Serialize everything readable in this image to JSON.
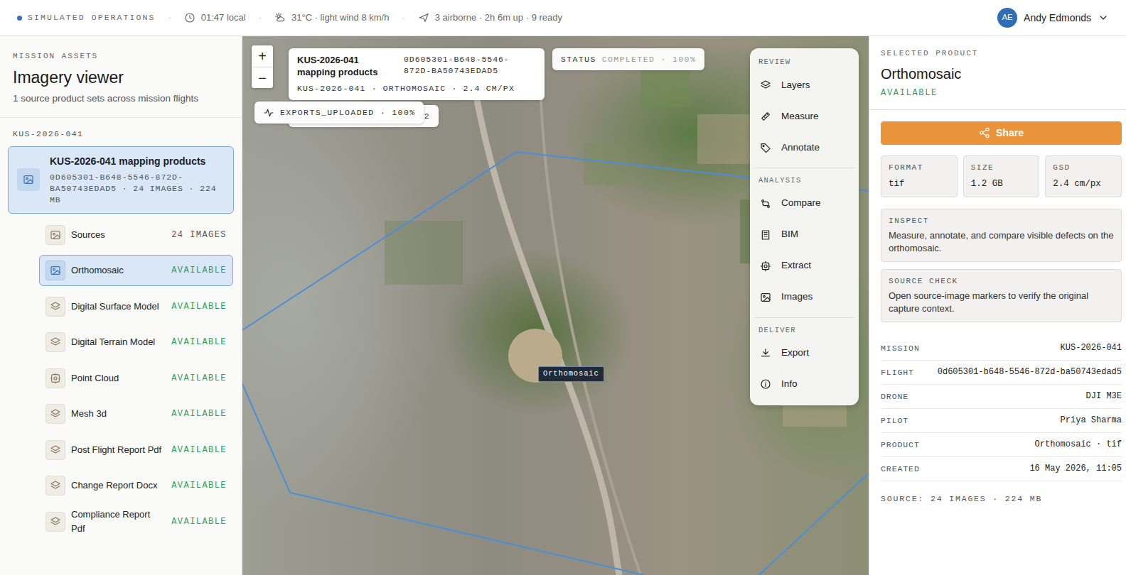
{
  "top_bar": {
    "mode": "SIMULATED OPERATIONS",
    "separator": "·",
    "time": "01:47 local",
    "weather": "31°C · light wind 8 km/h",
    "fleet": "3 airborne · 2h 6m up · 9 ready",
    "user": {
      "initials": "AE",
      "name": "Andy Edmonds"
    }
  },
  "sidebar": {
    "eyebrow": "MISSION ASSETS",
    "title": "Imagery viewer",
    "subtitle": "1 source product sets across mission flights",
    "group": "KUS-2026-041",
    "product_set": {
      "title": "KUS-2026-041 mapping products",
      "meta": "0D605301-B648-5546-872D-BA50743EDAD5 · 24 IMAGES · 224 MB",
      "selected": true
    },
    "items": [
      {
        "label": "Sources",
        "status": "24 IMAGES",
        "kind": "image",
        "color": "#555555",
        "selected": false
      },
      {
        "label": "Orthomosaic",
        "status": "AVAILABLE",
        "kind": "image",
        "color": "#2e9e5b",
        "selected": true
      },
      {
        "label": "Digital Surface Model",
        "status": "AVAILABLE",
        "kind": "layers",
        "color": "#2e9e5b",
        "selected": false
      },
      {
        "label": "Digital Terrain Model",
        "status": "AVAILABLE",
        "kind": "layers",
        "color": "#2e9e5b",
        "selected": false
      },
      {
        "label": "Point Cloud",
        "status": "AVAILABLE",
        "kind": "cloud",
        "color": "#2e9e5b",
        "selected": false
      },
      {
        "label": "Mesh 3d",
        "status": "AVAILABLE",
        "kind": "layers",
        "color": "#2e9e5b",
        "selected": false
      },
      {
        "label": "Post Flight Report Pdf",
        "status": "AVAILABLE",
        "kind": "layers",
        "color": "#2e9e5b",
        "selected": false
      },
      {
        "label": "Change Report Docx",
        "status": "AVAILABLE",
        "kind": "layers",
        "color": "#2e9e5b",
        "selected": false
      },
      {
        "label": "Compliance Report Pdf",
        "status": "AVAILABLE",
        "kind": "layers",
        "color": "#2e9e5b",
        "selected": false
      }
    ]
  },
  "map": {
    "zoom": [
      "+",
      "−"
    ],
    "info_card": {
      "title": "KUS-2026-041 mapping products",
      "id": "0D605301-B648-5546-872D-BA50743EDAD5",
      "line": "KUS-2026-041 · ORTHOMOSAIC · 2.4 CM/PX"
    },
    "status_chip": {
      "label": "STATUS",
      "value": "COMPLETED · 100%"
    },
    "exports_chip": "EXPORTS_UPLOADED · 100%",
    "hidden_chip": "82",
    "marker_label": "Orthomosaic",
    "tool_groups": [
      {
        "title": "REVIEW",
        "items": [
          {
            "label": "Layers",
            "kind": "layers"
          },
          {
            "label": "Measure",
            "kind": "measure"
          },
          {
            "label": "Annotate",
            "kind": "annotate"
          }
        ]
      },
      {
        "title": "ANALYSIS",
        "items": [
          {
            "label": "Compare",
            "kind": "compare"
          },
          {
            "label": "BIM",
            "kind": "bim"
          },
          {
            "label": "Extract",
            "kind": "extract"
          },
          {
            "label": "Images",
            "kind": "image"
          }
        ]
      },
      {
        "title": "DELIVER",
        "items": [
          {
            "label": "Export",
            "kind": "export"
          },
          {
            "label": "Info",
            "kind": "info"
          }
        ]
      }
    ]
  },
  "detail": {
    "eyebrow": "SELECTED PRODUCT",
    "title": "Orthomosaic",
    "status": "AVAILABLE",
    "share": "Share",
    "stats": [
      {
        "label": "FORMAT",
        "value": "tif"
      },
      {
        "label": "SIZE",
        "value": "1.2 GB"
      },
      {
        "label": "GSD",
        "value": "2.4 cm/px"
      }
    ],
    "notes": [
      {
        "title": "INSPECT",
        "text": "Measure, annotate, and compare visible defects on the orthomosaic."
      },
      {
        "title": "SOURCE CHECK",
        "text": "Open source-image markers to verify the original capture context."
      }
    ],
    "fields": [
      {
        "label": "MISSION",
        "value": "KUS-2026-041"
      },
      {
        "label": "FLIGHT",
        "value": "0d605301-b648-5546-872d-ba50743edad5"
      },
      {
        "label": "DRONE",
        "value": "DJI M3E"
      },
      {
        "label": "PILOT",
        "value": "Priya Sharma"
      },
      {
        "label": "PRODUCT",
        "value": "Orthomosaic · tif"
      },
      {
        "label": "CREATED",
        "value": "16 May 2026, 11:05"
      }
    ],
    "footer": "SOURCE: 24 IMAGES · 224 MB"
  }
}
